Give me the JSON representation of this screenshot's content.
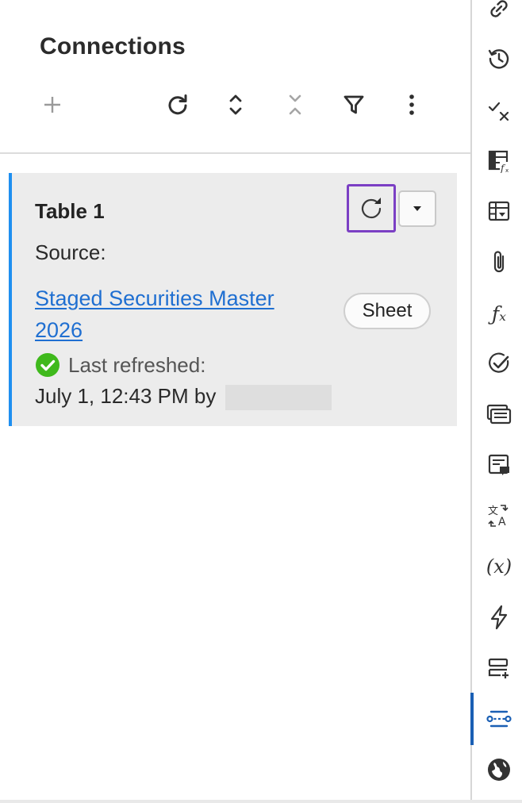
{
  "panel": {
    "title": "Connections"
  },
  "toolbar": {
    "buttons": [
      {
        "icon": "plus-icon"
      },
      {
        "icon": "refresh-icon"
      },
      {
        "icon": "expand-icon"
      },
      {
        "icon": "collapse-icon"
      },
      {
        "icon": "filter-icon"
      },
      {
        "icon": "more-vertical-icon"
      }
    ]
  },
  "connection_card": {
    "title": "Table 1",
    "source_label": "Source:",
    "source_link": "Staged Securities Master 2026",
    "source_type_badge": "Sheet",
    "status_label": "Last refreshed:",
    "refreshed_at": "July 1, 12:43 PM by",
    "accent_color": "#1f8ff0",
    "status_color": "#3fb91c",
    "highlight_color": "#7b3fc4"
  },
  "rail": {
    "items": [
      {
        "icon": "link-icon"
      },
      {
        "icon": "history-icon"
      },
      {
        "icon": "check-cross-icon"
      },
      {
        "icon": "sheet-formula-icon"
      },
      {
        "icon": "table-dropdown-icon"
      },
      {
        "icon": "attachment-icon"
      },
      {
        "icon": "function-icon",
        "glyph": "ƒₓ"
      },
      {
        "icon": "check-circle-icon"
      },
      {
        "icon": "card-list-icon"
      },
      {
        "icon": "comment-card-icon"
      },
      {
        "icon": "translate-icon"
      },
      {
        "icon": "variable-icon",
        "glyph": "(x)"
      },
      {
        "icon": "lightning-icon"
      },
      {
        "icon": "rows-add-icon"
      },
      {
        "icon": "connections-icon",
        "active": true
      },
      {
        "icon": "globe-icon"
      }
    ],
    "active_color": "#1a5fb4"
  }
}
